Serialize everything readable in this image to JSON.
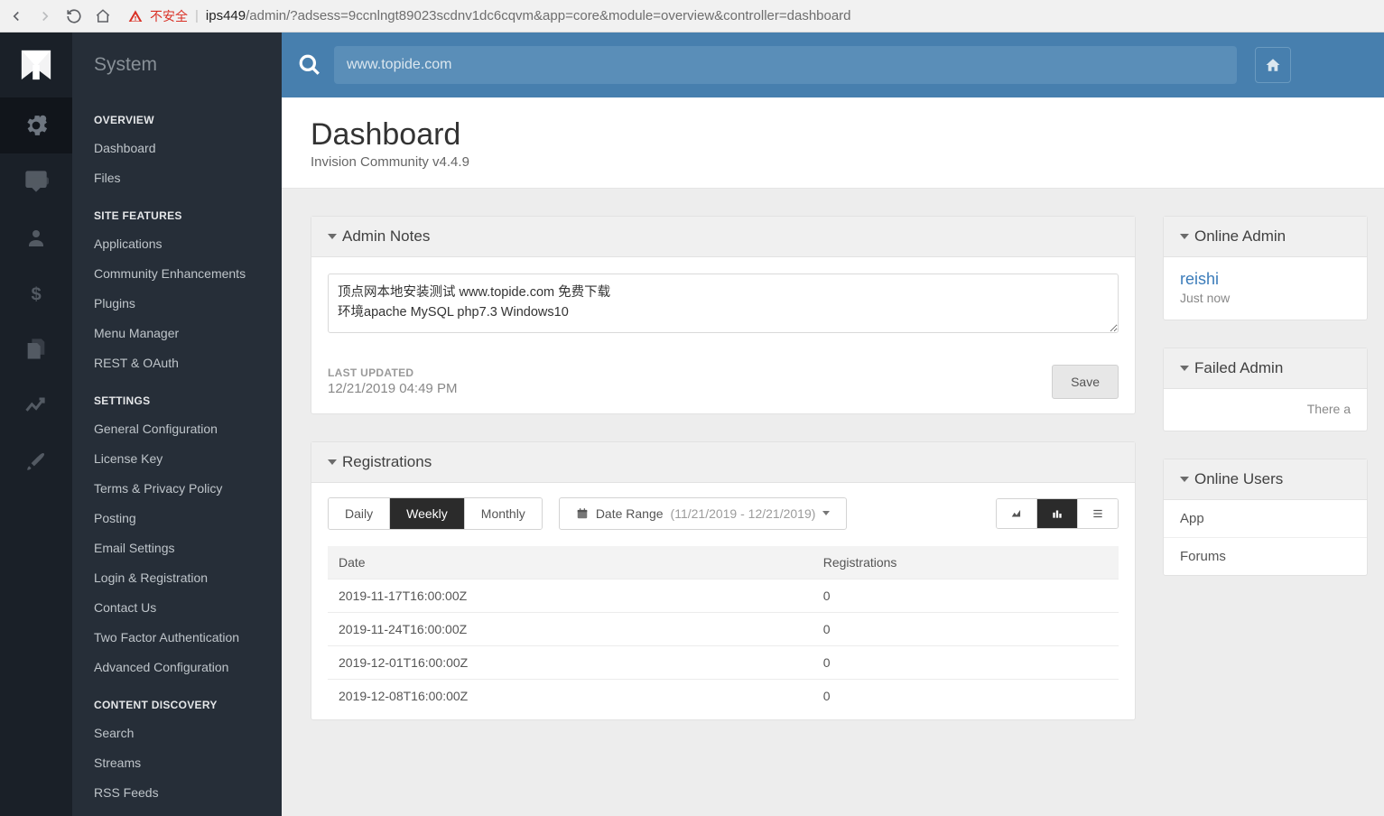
{
  "browser": {
    "insecure_label": "不安全",
    "url_host": "ips449",
    "url_path": "/admin/?adsess=9ccnlngt89023scdnv1dc6cqvm&app=core&module=overview&controller=dashboard"
  },
  "sidebar": {
    "title": "System",
    "sections": [
      {
        "head": "OVERVIEW",
        "items": [
          "Dashboard",
          "Files"
        ]
      },
      {
        "head": "SITE FEATURES",
        "items": [
          "Applications",
          "Community Enhancements",
          "Plugins",
          "Menu Manager",
          "REST & OAuth"
        ]
      },
      {
        "head": "SETTINGS",
        "items": [
          "General Configuration",
          "License Key",
          "Terms & Privacy Policy",
          "Posting",
          "Email Settings",
          "Login & Registration",
          "Contact Us",
          "Two Factor Authentication",
          "Advanced Configuration"
        ]
      },
      {
        "head": "CONTENT DISCOVERY",
        "items": [
          "Search",
          "Streams",
          "RSS Feeds"
        ]
      }
    ]
  },
  "search_placeholder": "www.topide.com",
  "page": {
    "title": "Dashboard",
    "subtitle": "Invision Community v4.4.9"
  },
  "admin_notes": {
    "title": "Admin Notes",
    "text": "顶点网本地安装测试 www.topide.com 免费下载\n环境apache MySQL php7.3 Windows10",
    "last_updated_label": "LAST UPDATED",
    "last_updated_value": "12/21/2019 04:49 PM",
    "save_label": "Save"
  },
  "registrations": {
    "title": "Registrations",
    "tabs": {
      "daily": "Daily",
      "weekly": "Weekly",
      "monthly": "Monthly"
    },
    "date_range_label": "Date Range",
    "date_range_value": "(11/21/2019 - 12/21/2019)",
    "columns": {
      "date": "Date",
      "count": "Registrations"
    },
    "rows": [
      {
        "date": "2019-11-17T16:00:00Z",
        "count": "0"
      },
      {
        "date": "2019-11-24T16:00:00Z",
        "count": "0"
      },
      {
        "date": "2019-12-01T16:00:00Z",
        "count": "0"
      },
      {
        "date": "2019-12-08T16:00:00Z",
        "count": "0"
      }
    ]
  },
  "online_admins": {
    "title": "Online Admin",
    "user": "reishi",
    "time": "Just now"
  },
  "failed_logins": {
    "title": "Failed Admin",
    "empty": "There a"
  },
  "online_users": {
    "title": "Online Users",
    "rows": [
      "App",
      "Forums"
    ]
  },
  "chart_data": {
    "type": "table",
    "title": "Registrations",
    "columns": [
      "Date",
      "Registrations"
    ],
    "rows": [
      [
        "2019-11-17T16:00:00Z",
        0
      ],
      [
        "2019-11-24T16:00:00Z",
        0
      ],
      [
        "2019-12-01T16:00:00Z",
        0
      ],
      [
        "2019-12-08T16:00:00Z",
        0
      ]
    ]
  }
}
